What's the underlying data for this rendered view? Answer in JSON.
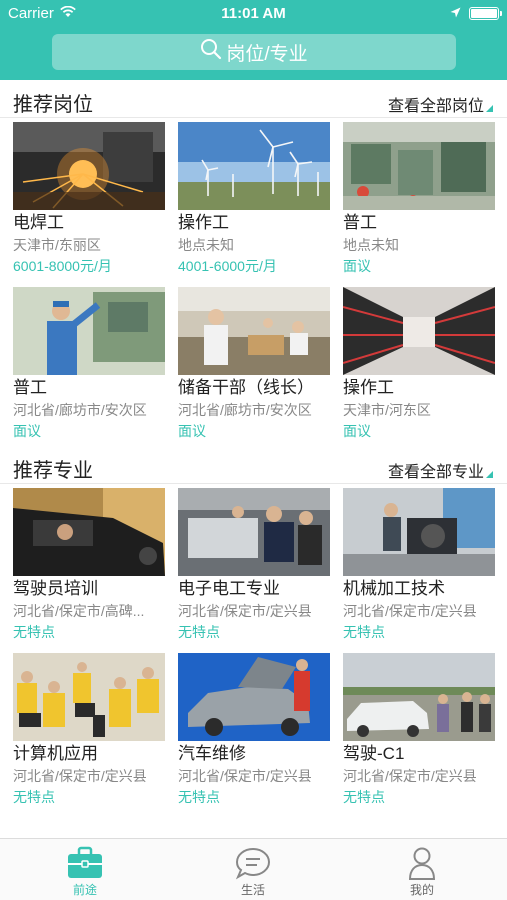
{
  "status": {
    "carrier": "Carrier",
    "time": "11:01 AM"
  },
  "search": {
    "placeholder": "岗位/专业"
  },
  "jobs_section": {
    "title": "推荐岗位",
    "more": "查看全部岗位",
    "items": [
      {
        "title": "电焊工",
        "location": "天津市/东丽区",
        "note": "6001-8000元/月"
      },
      {
        "title": "操作工",
        "location": "地点未知",
        "note": "4001-6000元/月"
      },
      {
        "title": "普工",
        "location": "地点未知",
        "note": "面议"
      },
      {
        "title": "普工",
        "location": "河北省/廊坊市/安次区",
        "note": "面议"
      },
      {
        "title": "储备干部（线长）",
        "location": "河北省/廊坊市/安次区",
        "note": "面议"
      },
      {
        "title": "操作工",
        "location": "天津市/河东区",
        "note": "面议"
      }
    ]
  },
  "majors_section": {
    "title": "推荐专业",
    "more": "查看全部专业",
    "items": [
      {
        "title": "驾驶员培训",
        "location": "河北省/保定市/高碑...",
        "note": "无特点"
      },
      {
        "title": "电子电工专业",
        "location": "河北省/保定市/定兴县",
        "note": "无特点"
      },
      {
        "title": "机械加工技术",
        "location": "河北省/保定市/定兴县",
        "note": "无特点"
      },
      {
        "title": "计算机应用",
        "location": "河北省/保定市/定兴县",
        "note": "无特点"
      },
      {
        "title": "汽车维修",
        "location": "河北省/保定市/定兴县",
        "note": "无特点"
      },
      {
        "title": "驾驶-C1",
        "location": "河北省/保定市/定兴县",
        "note": "无特点"
      }
    ]
  },
  "tabbar": {
    "tabs": [
      {
        "label": "前途",
        "icon": "briefcase-icon",
        "active": true
      },
      {
        "label": "生活",
        "icon": "chat-bubble-icon",
        "active": false
      },
      {
        "label": "我的",
        "icon": "person-icon",
        "active": false
      }
    ]
  },
  "colors": {
    "accent": "#36c2b2",
    "search_bg": "#7ed7cc"
  }
}
